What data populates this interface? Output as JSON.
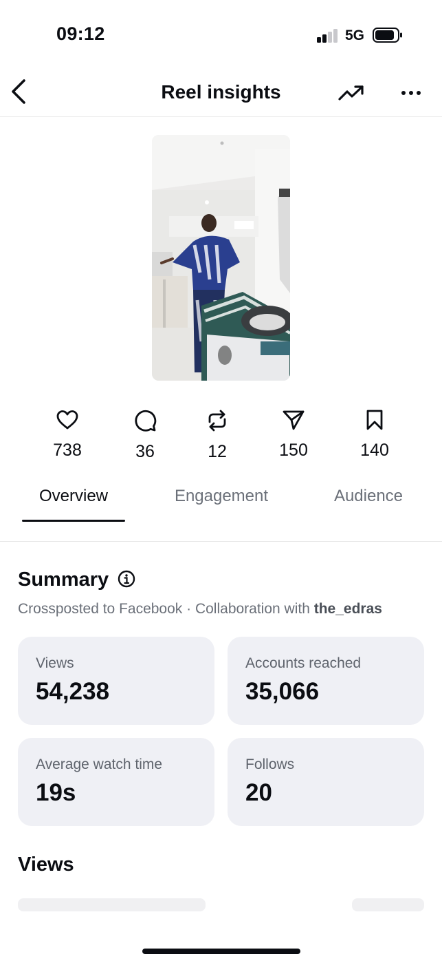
{
  "status_bar": {
    "time": "09:12",
    "network": "5G",
    "icons": [
      "signal-icon",
      "battery-icon"
    ]
  },
  "header": {
    "title": "Reel insights",
    "icons": [
      "back-arrow-icon",
      "trending-up-icon",
      "more-options-icon"
    ]
  },
  "stats": [
    {
      "icon": "heart-icon",
      "count": "738"
    },
    {
      "icon": "comment-icon",
      "count": "36"
    },
    {
      "icon": "repost-icon",
      "count": "12"
    },
    {
      "icon": "share-icon",
      "count": "150"
    },
    {
      "icon": "bookmark-icon",
      "count": "140"
    }
  ],
  "tabs": [
    {
      "label": "Overview",
      "active": true
    },
    {
      "label": "Engagement",
      "active": false
    },
    {
      "label": "Audience",
      "active": false
    }
  ],
  "summary": {
    "title": "Summary",
    "subtitle_prefix": "Crossposted to Facebook · Collaboration with ",
    "collaborator": "the_edras",
    "cards": [
      {
        "label": "Views",
        "value": "54,238"
      },
      {
        "label": "Accounts reached",
        "value": "35,066"
      },
      {
        "label": "Average watch time",
        "value": "19s"
      },
      {
        "label": "Follows",
        "value": "20"
      }
    ]
  },
  "views_section": {
    "title": "Views"
  },
  "colors": {
    "text_primary": "#0b0d12",
    "text_secondary": "#6b7079",
    "card_background": "#eff0f5",
    "divider": "#ececec"
  }
}
